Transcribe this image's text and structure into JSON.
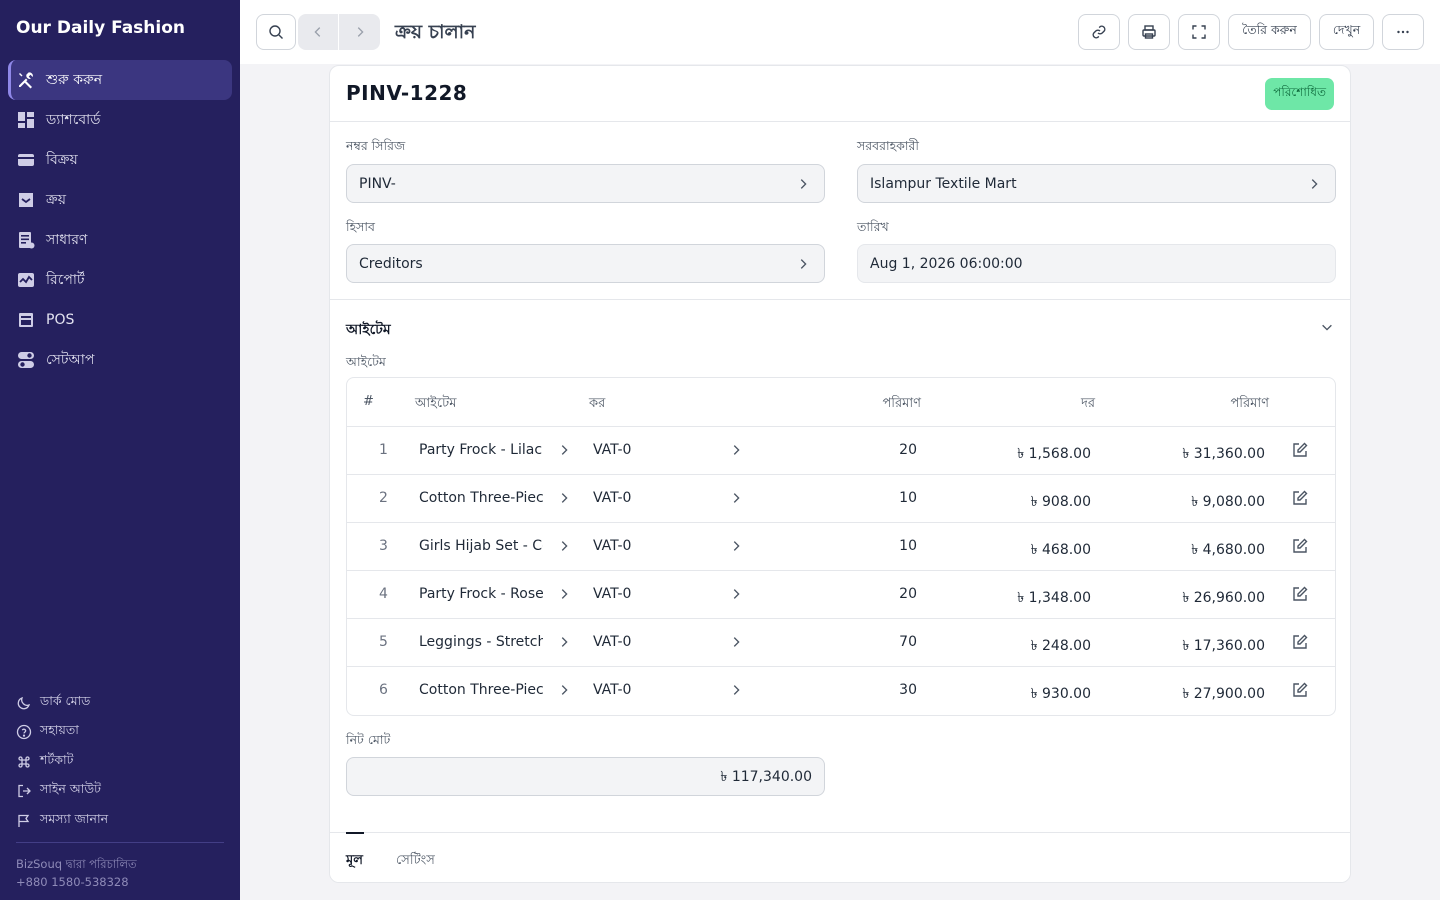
{
  "sidebar": {
    "brand": "Our Daily Fashion",
    "items": [
      {
        "label": "শুরু করুন",
        "icon": "tools-icon"
      },
      {
        "label": "ড্যাশবোর্ড",
        "icon": "dashboard-icon"
      },
      {
        "label": "বিক্রয়",
        "icon": "card-icon"
      },
      {
        "label": "ক্রয়",
        "icon": "inbox-icon"
      },
      {
        "label": "সাধারণ",
        "icon": "ledger-icon"
      },
      {
        "label": "রিপোর্ট",
        "icon": "chart-icon"
      },
      {
        "label": "POS",
        "icon": "pos-icon"
      },
      {
        "label": "সেটআপ",
        "icon": "toggles-icon"
      }
    ],
    "bottom_links": [
      {
        "label": "ডার্ক মোড",
        "icon": "moon-icon"
      },
      {
        "label": "সহায়তা",
        "icon": "help-icon"
      },
      {
        "label": "শর্টকাট",
        "icon": "command-icon"
      },
      {
        "label": "সাইন আউট",
        "icon": "sign-out-icon"
      },
      {
        "label": "সমস্যা জানান",
        "icon": "flag-icon"
      }
    ],
    "powered_by": "BizSouq দ্বারা পরিচালিত",
    "phone": "+880 1580-538328"
  },
  "topbar": {
    "title": "ক্রয় চালান",
    "create_label": "তৈরি করুন",
    "view_label": "দেখুন"
  },
  "document": {
    "id": "PINV-1228",
    "status": "পরিশোধিত",
    "fields": {
      "series_label": "নম্বর সিরিজ",
      "series_value": "PINV-",
      "supplier_label": "সরবরাহকারী",
      "supplier_value": "Islampur Textile Mart",
      "account_label": "হিসাব",
      "account_value": "Creditors",
      "date_label": "তারিখ",
      "date_value": "Aug 1, 2026 06:00:00"
    },
    "items_section_title": "আইটেম",
    "items_label": "আইটেম",
    "columns": {
      "idx": "#",
      "item": "আইটেম",
      "tax": "কর",
      "qty": "পরিমাণ",
      "rate": "দর",
      "amount": "পরিমাণ"
    },
    "rows": [
      {
        "idx": "1",
        "item": "Party Frock - Lilac",
        "tax": "VAT-0",
        "qty": "20",
        "rate": "৳ 1,568.00",
        "amount": "৳ 31,360.00"
      },
      {
        "idx": "2",
        "item": "Cotton Three-Piece",
        "tax": "VAT-0",
        "qty": "10",
        "rate": "৳ 908.00",
        "amount": "৳ 9,080.00"
      },
      {
        "idx": "3",
        "item": "Girls Hijab Set - Cotton",
        "tax": "VAT-0",
        "qty": "10",
        "rate": "৳ 468.00",
        "amount": "৳ 4,680.00"
      },
      {
        "idx": "4",
        "item": "Party Frock - Rose",
        "tax": "VAT-0",
        "qty": "20",
        "rate": "৳ 1,348.00",
        "amount": "৳ 26,960.00"
      },
      {
        "idx": "5",
        "item": "Leggings - Stretch",
        "tax": "VAT-0",
        "qty": "70",
        "rate": "৳ 248.00",
        "amount": "৳ 17,360.00"
      },
      {
        "idx": "6",
        "item": "Cotton Three-Piece",
        "tax": "VAT-0",
        "qty": "30",
        "rate": "৳ 930.00",
        "amount": "৳ 27,900.00"
      }
    ],
    "net_total_label": "নিট মোট",
    "net_total_value": "৳ 117,340.00",
    "tabs": [
      "মূল",
      "সেটিংস"
    ]
  },
  "colors": {
    "sidebar_bg": "#25205e",
    "badge_bg": "#6ee7a7",
    "badge_text": "#0f6b3d"
  }
}
